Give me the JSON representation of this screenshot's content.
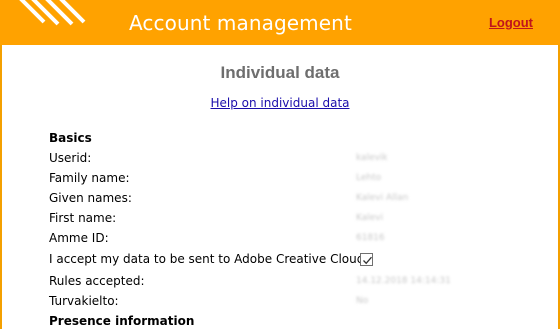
{
  "header": {
    "title": "Account management",
    "logout_label": "Logout",
    "logo_icon": "diagonal-stripes-logo",
    "bg_color": "#ffa200"
  },
  "page": {
    "title": "Individual data",
    "help_link": "Help on individual data"
  },
  "sections": {
    "basics": "Basics",
    "presence": "Presence information"
  },
  "fields": [
    {
      "label": "Userid:",
      "value": "kalevik"
    },
    {
      "label": "Family name:",
      "value": "Lehto"
    },
    {
      "label": "Given names:",
      "value": "Kalevi Allan"
    },
    {
      "label": "First name:",
      "value": "Kalevi"
    },
    {
      "label": "Amme ID:",
      "value": "61816"
    },
    {
      "label": "I accept my data to be sent to Adobe Creative Cloud:",
      "checked": true
    },
    {
      "label": "Rules accepted:",
      "value": "14.12.2018 14:14:31"
    },
    {
      "label": "Turvakielto:",
      "value": "No"
    }
  ]
}
